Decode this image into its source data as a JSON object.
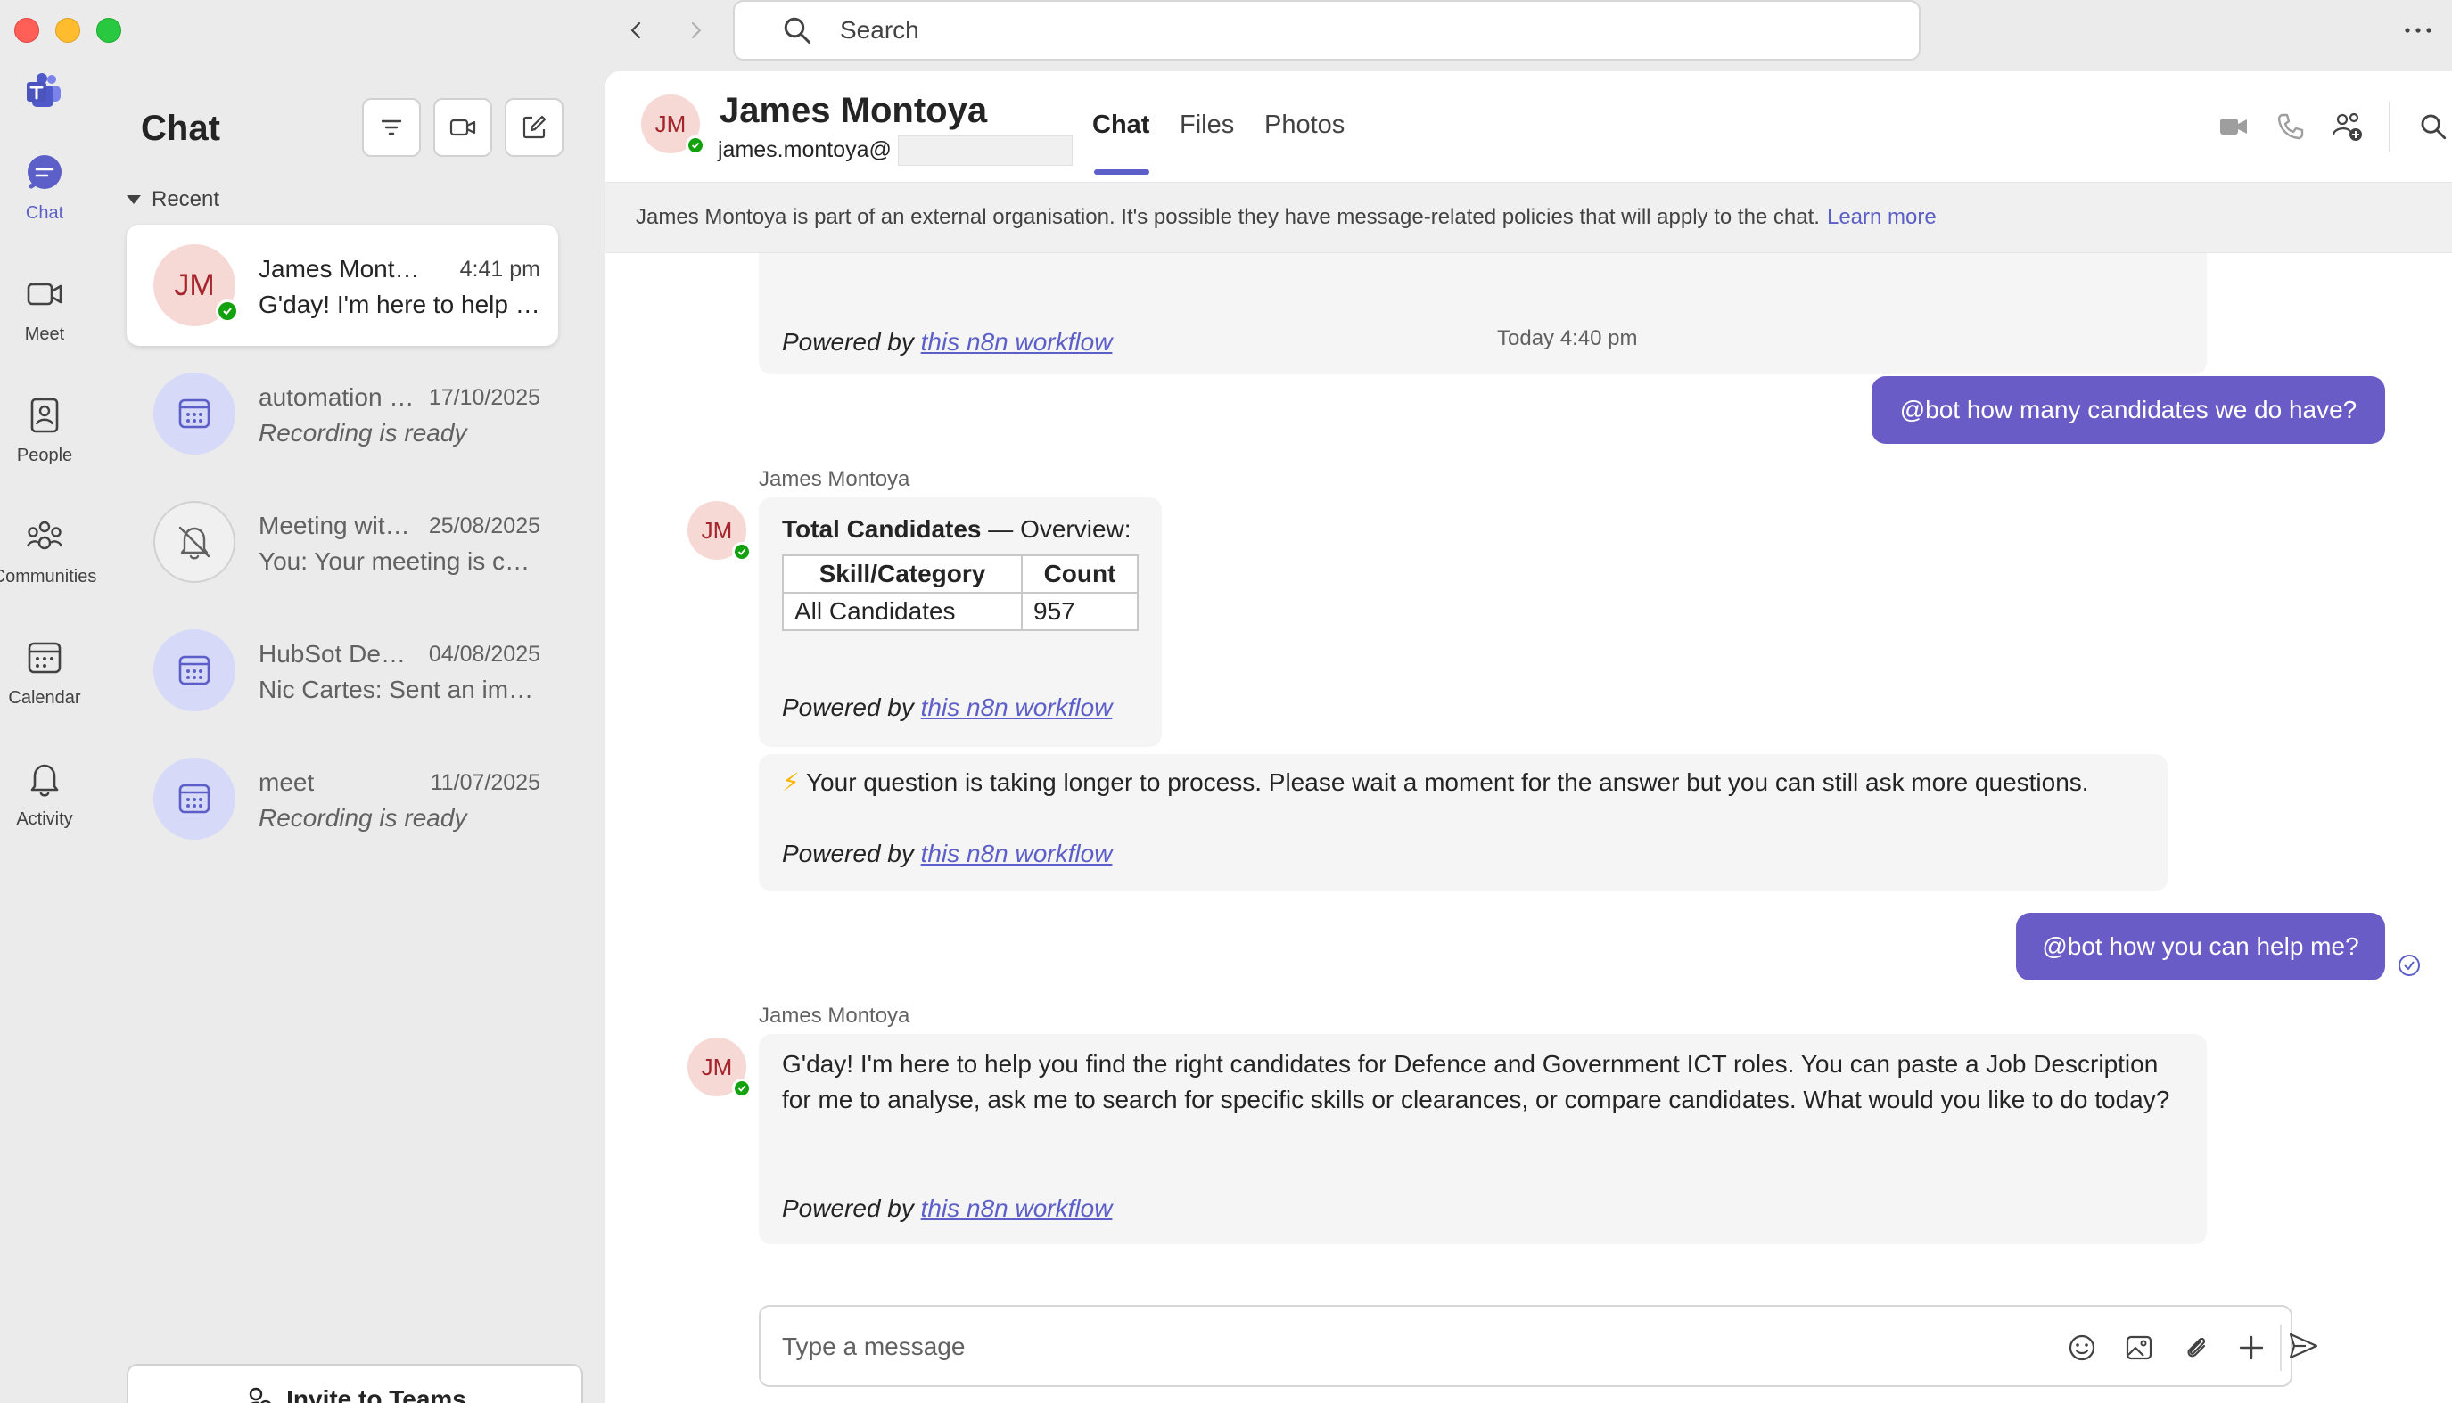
{
  "topbar": {
    "search_placeholder": "Search"
  },
  "rail": {
    "items": [
      {
        "label": "Chat",
        "icon": "chat-icon",
        "active": true
      },
      {
        "label": "Meet",
        "icon": "video-camera-icon"
      },
      {
        "label": "People",
        "icon": "contact-book-icon"
      },
      {
        "label": "Communities",
        "icon": "communities-icon"
      },
      {
        "label": "Calendar",
        "icon": "calendar-icon"
      },
      {
        "label": "Activity",
        "icon": "bell-icon"
      }
    ]
  },
  "chatlist": {
    "title": "Chat",
    "section": "Recent",
    "items": [
      {
        "initials": "JM",
        "name": "James Montoya",
        "time": "4:41 pm",
        "preview": "G'day! I'm here to help you find the right candidates",
        "type": "person",
        "active": true
      },
      {
        "name": "automation meeting",
        "time": "17/10/2025",
        "preview": "Recording is ready",
        "type": "meeting"
      },
      {
        "name": "Meeting with the team",
        "time": "25/08/2025",
        "preview": "You: Your meeting is confirmed",
        "type": "muted"
      },
      {
        "name": "HubSot Demo",
        "time": "04/08/2025",
        "preview": "Nic Cartes: Sent an image",
        "type": "meeting"
      },
      {
        "name": "meet",
        "time": "11/07/2025",
        "preview": "Recording is ready",
        "type": "meeting"
      }
    ],
    "invite_label": "Invite to Teams"
  },
  "header": {
    "initials": "JM",
    "name": "James Montoya",
    "email": "james.montoya@",
    "tabs": [
      "Chat",
      "Files",
      "Photos"
    ]
  },
  "banner": {
    "text": "James Montoya is part of an external organisation. It's possible they have message-related policies that will apply to the chat.",
    "link": "Learn more"
  },
  "messages": {
    "powered_prefix": "Powered by",
    "powered_link": "this n8n workflow",
    "timestamp": "Today 4:40 pm",
    "user_msg_1": "@bot how many candidates we do have?",
    "sender_1": "James Montoya",
    "avatar_initials": "JM",
    "bot_table": {
      "title_bold": "Total Candidates",
      "title_rest": " — Overview:",
      "headers": [
        "Skill/Category",
        "Count"
      ],
      "rows": [
        [
          "All Candidates",
          "957"
        ]
      ]
    },
    "bot_wait_icon": "⚡",
    "bot_wait": "Your question is taking longer to process. Please wait a moment for the answer but you can still ask more questions.",
    "user_msg_2": "@bot how you can help me?",
    "sender_2": "James Montoya",
    "bot_help": "G'day! I'm here to help you find the right candidates for Defence and Government ICT roles. You can paste a Job Description for me to analyse, ask me to search for specific skills or clearances, or compare candidates. What would you like to do today?"
  },
  "composer": {
    "placeholder": "Type a message"
  },
  "colors": {
    "accent": "#5b5fc7",
    "user_bubble": "#6a5cc6",
    "presence": "#13a10e",
    "avatar_bg": "#f6d9d4"
  }
}
